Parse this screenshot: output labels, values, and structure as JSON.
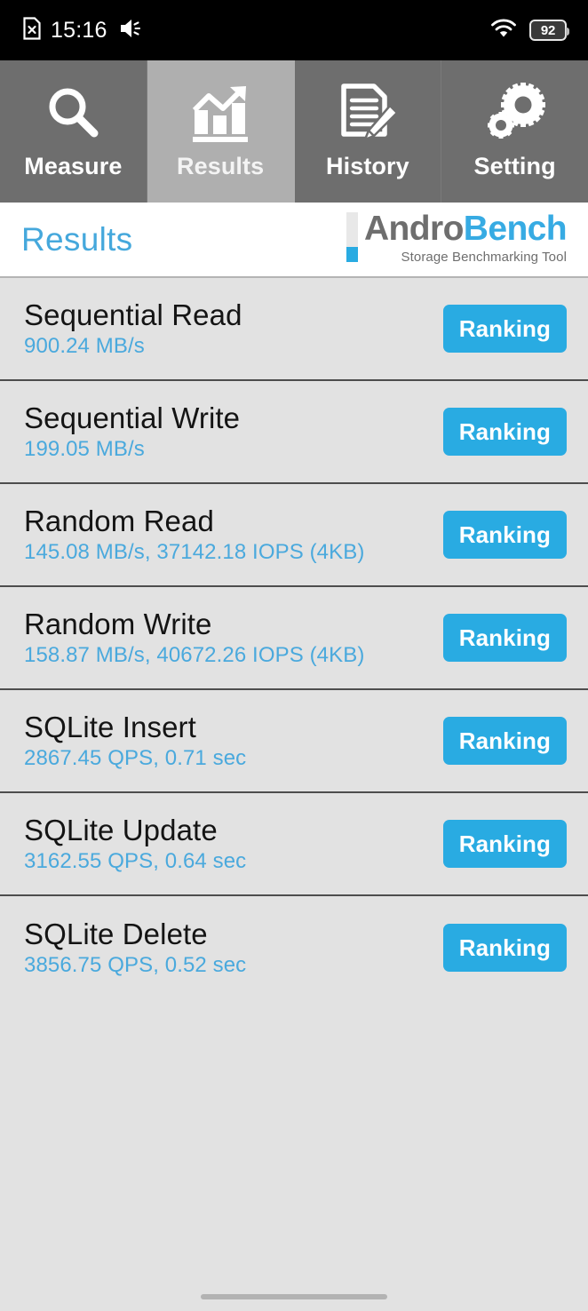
{
  "statusbar": {
    "time": "15:16",
    "battery_level": "92",
    "icons": {
      "sim": "sim-card-off-icon",
      "volume": "volume-icon",
      "wifi": "wifi-icon",
      "battery": "battery-icon"
    }
  },
  "tabs": [
    {
      "label": "Measure",
      "icon": "magnifier-icon",
      "active": false
    },
    {
      "label": "Results",
      "icon": "bar-chart-arrow-icon",
      "active": true
    },
    {
      "label": "History",
      "icon": "document-pencil-icon",
      "active": false
    },
    {
      "label": "Setting",
      "icon": "gears-icon",
      "active": false
    }
  ],
  "header": {
    "title": "Results",
    "logo": {
      "part1": "Andro",
      "part2": "Bench",
      "subtitle": "Storage Benchmarking Tool"
    }
  },
  "colors": {
    "accent_blue": "#29abe2",
    "value_blue": "#4aa9dd",
    "tab_inactive": "#6e6e6e",
    "tab_active": "#afafaf",
    "list_bg": "#e2e2e2",
    "logo_gray": "#6e6e6e"
  },
  "results": {
    "button_label": "Ranking",
    "rows": [
      {
        "title": "Sequential Read",
        "value": "900.24 MB/s"
      },
      {
        "title": "Sequential Write",
        "value": "199.05 MB/s"
      },
      {
        "title": "Random Read",
        "value": "145.08 MB/s, 37142.18 IOPS (4KB)"
      },
      {
        "title": "Random Write",
        "value": "158.87 MB/s, 40672.26 IOPS (4KB)"
      },
      {
        "title": "SQLite Insert",
        "value": "2867.45 QPS, 0.71 sec"
      },
      {
        "title": "SQLite Update",
        "value": "3162.55 QPS, 0.64 sec"
      },
      {
        "title": "SQLite Delete",
        "value": "3856.75 QPS, 0.52 sec"
      }
    ]
  }
}
